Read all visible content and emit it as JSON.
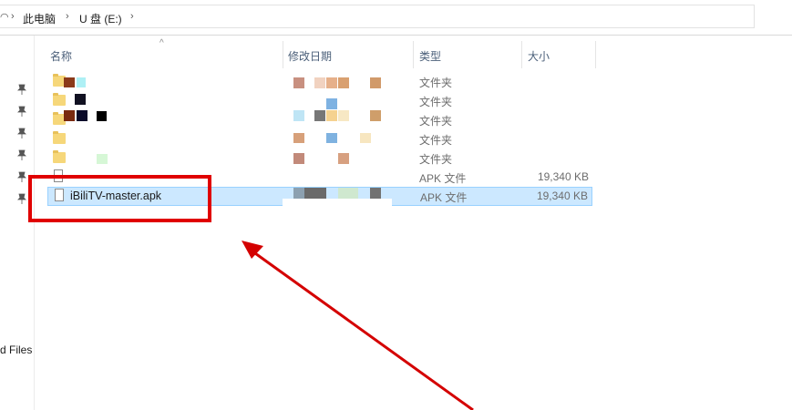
{
  "address": {
    "crumbs": [
      "此电脑",
      "U 盘 (E:)"
    ]
  },
  "nav": {
    "partial_label": "d Files"
  },
  "columns": {
    "name": "名称",
    "date": "修改日期",
    "type": "类型",
    "size": "大小"
  },
  "rows": [
    {
      "name": "",
      "type": "文件夹",
      "size": "",
      "icon": "folder-icon"
    },
    {
      "name": "",
      "type": "文件夹",
      "size": "",
      "icon": "folder-icon"
    },
    {
      "name": "",
      "type": "文件夹",
      "size": "",
      "icon": "folder-icon"
    },
    {
      "name": "",
      "type": "文件夹",
      "size": "",
      "icon": "folder-icon"
    },
    {
      "name": "",
      "type": "文件夹",
      "size": "",
      "icon": "folder-icon"
    },
    {
      "name": "",
      "type": "APK 文件",
      "size": "19,340 KB",
      "icon": "file-icon"
    },
    {
      "name": "iBiliTV-master.apk",
      "type": "APK 文件",
      "size": "19,340 KB",
      "icon": "file-icon",
      "selected": true
    }
  ],
  "colors": {
    "selection": "#cce8ff",
    "annotation": "#e00000"
  }
}
